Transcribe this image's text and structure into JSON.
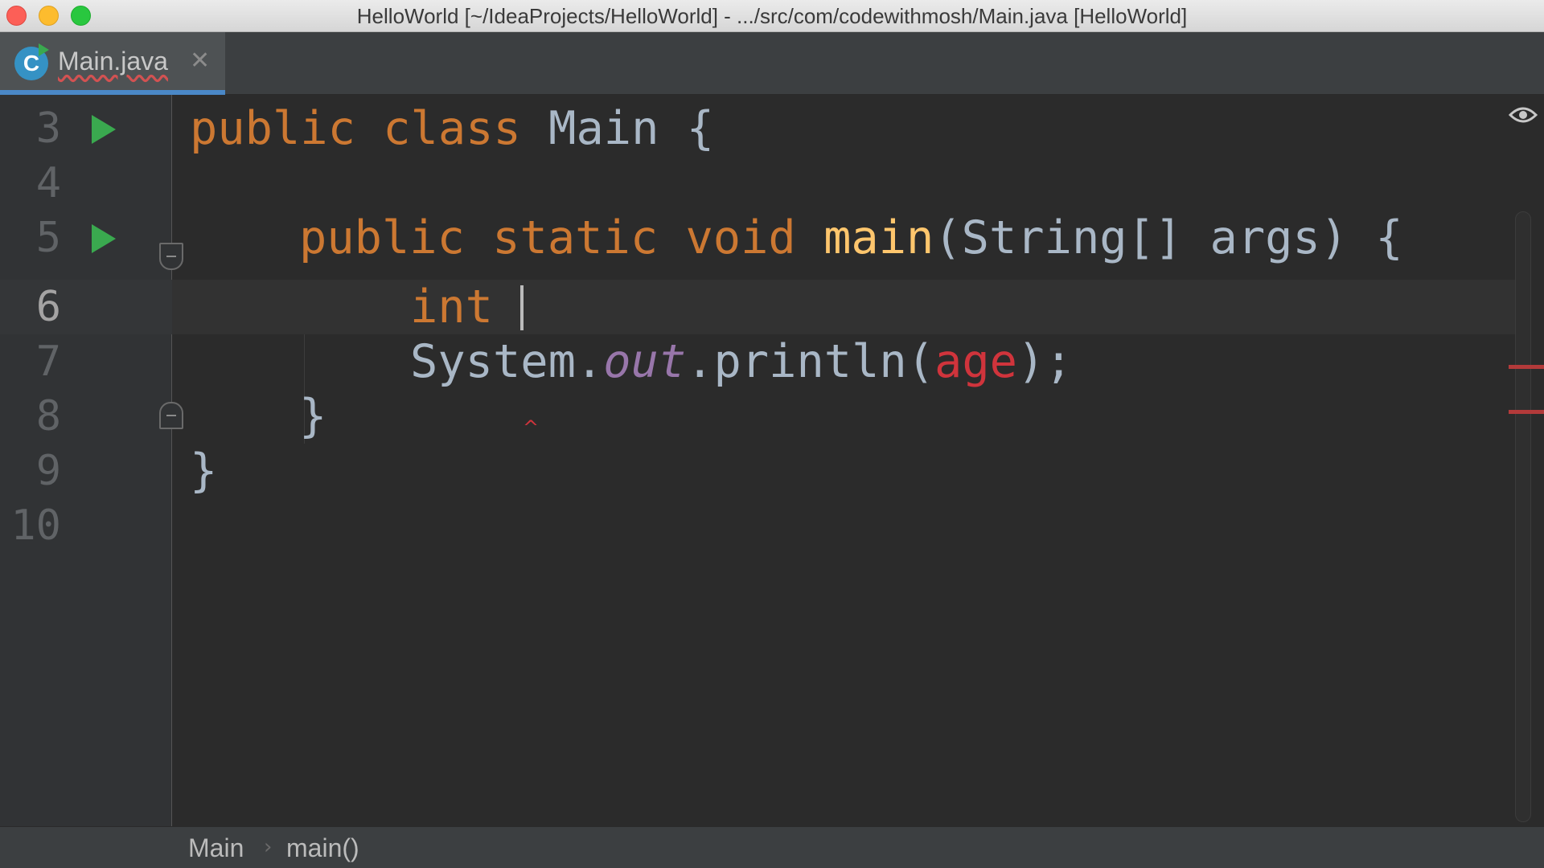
{
  "window": {
    "title": "HelloWorld [~/IdeaProjects/HelloWorld] - .../src/com/codewithmosh/Main.java [HelloWorld]"
  },
  "tabs": [
    {
      "label": "Main.java",
      "icon": "java-class-icon",
      "icon_letter": "C",
      "active": true
    }
  ],
  "editor": {
    "partial_top_line": "2",
    "current_line": 6,
    "lines": [
      {
        "number": "3",
        "tokens": [
          "public",
          "class",
          "Main",
          "{"
        ],
        "run": true
      },
      {
        "number": "4",
        "tokens": []
      },
      {
        "number": "5",
        "tokens": [
          "public",
          "static",
          "void",
          "main",
          "(String[] args) {"
        ],
        "run": true
      },
      {
        "number": "6",
        "tokens": [
          "int"
        ]
      },
      {
        "number": "7",
        "tokens": [
          "System.",
          "out",
          ".println(",
          "age",
          ");"
        ]
      },
      {
        "number": "8",
        "tokens": [
          "}"
        ]
      },
      {
        "number": "9",
        "tokens": [
          "}"
        ]
      },
      {
        "number": "10",
        "tokens": []
      }
    ]
  },
  "colors": {
    "keyword": "#cc7832",
    "function": "#ffc66d",
    "static_field": "#9876aa",
    "error": "#d0343c",
    "default_text": "#a9b7c6"
  },
  "breadcrumb": {
    "items": [
      "Main",
      "main()"
    ]
  }
}
